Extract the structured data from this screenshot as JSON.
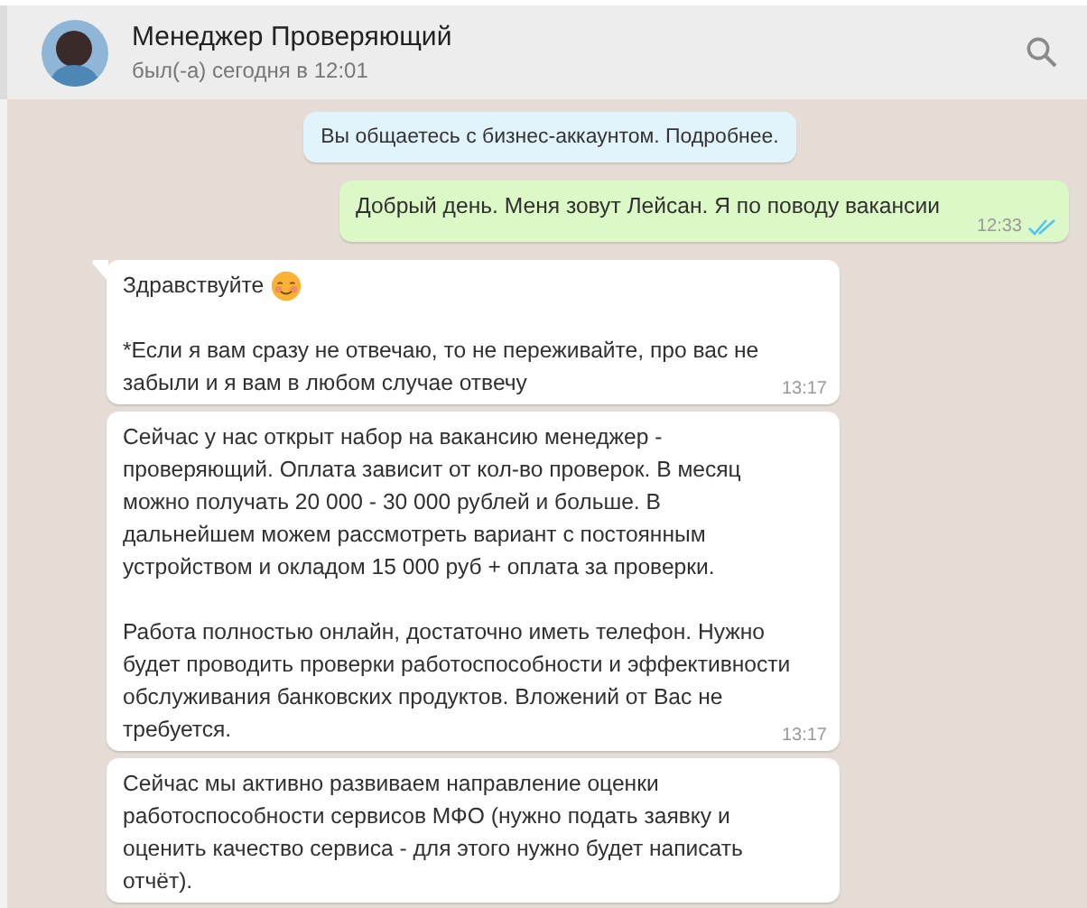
{
  "header": {
    "title": "Менеджер Проверяющий",
    "status": "был(-а) сегодня в 12:01"
  },
  "messages": [
    {
      "kind": "system",
      "paragraphs": [
        "Вы общаетесь с бизнес-аккаунтом. Подробнее."
      ]
    },
    {
      "kind": "outgoing",
      "paragraphs": [
        "Добрый день. Меня зовут Лейсан. Я по поводу вакансии"
      ],
      "time": "12:33",
      "read": true
    },
    {
      "kind": "incoming",
      "tail": true,
      "emoji": true,
      "paragraphs": [
        "Здравствуйте",
        "*Если я вам сразу не отвечаю, то не переживайте, про вас не\nзабыли и я вам в любом случае отвечу"
      ],
      "time": "13:17"
    },
    {
      "kind": "incoming",
      "tail": false,
      "paragraphs": [
        "Сейчас у нас открыт набор на вакансию менеджер -\nпроверяющий. Оплата зависит от кол-во проверок. В месяц\nможно получать 20 000 - 30 000 рублей и больше. В\nдальнейшем можем рассмотреть вариант  с постоянным\nустройством  и окладом 15 000 руб + оплата за проверки.",
        "Работа полностью онлайн, достаточно иметь телефон. Нужно\nбудет проводить проверки работоспособности и эффективности\nобслуживания банковских продуктов. Вложений от Вас не\nтребуется."
      ],
      "time": "13:17"
    },
    {
      "kind": "incoming",
      "tail": false,
      "paragraphs": [
        "Сейчас мы активно развиваем направление оценки\nработоспособности сервисов МФО (нужно подать заявку и\nоценить качество сервиса - для этого нужно будет написать\nотчёт)."
      ]
    }
  ]
}
